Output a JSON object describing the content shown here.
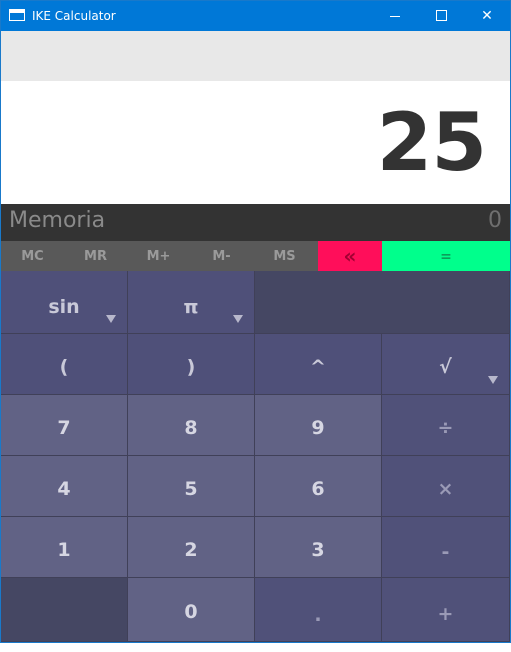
{
  "window": {
    "title": "IKE Calculator",
    "controls": {
      "minimize": "minimize",
      "maximize": "maximize",
      "close": "✕"
    }
  },
  "display": {
    "value": "25",
    "history": ""
  },
  "memory": {
    "label": "Memoria",
    "value": "0",
    "buttons": [
      "MC",
      "MR",
      "M+",
      "M-",
      "MS"
    ],
    "backspace": "«",
    "equals": "="
  },
  "keys": {
    "sin": "sin",
    "pi": "π",
    "open_paren": "(",
    "close_paren": ")",
    "power": "^",
    "sqrt": "√",
    "seven": "7",
    "eight": "8",
    "nine": "9",
    "divide": "÷",
    "four": "4",
    "five": "5",
    "six": "6",
    "multiply": "×",
    "one": "1",
    "two": "2",
    "three": "3",
    "minus": "-",
    "zero": "0",
    "dot": ".",
    "plus": "+"
  },
  "colors": {
    "titlebar": "#0078d7",
    "backspace": "#ff0e5a",
    "equals": "#00ff8c",
    "keypad": "#616285",
    "operator": "#505179"
  }
}
